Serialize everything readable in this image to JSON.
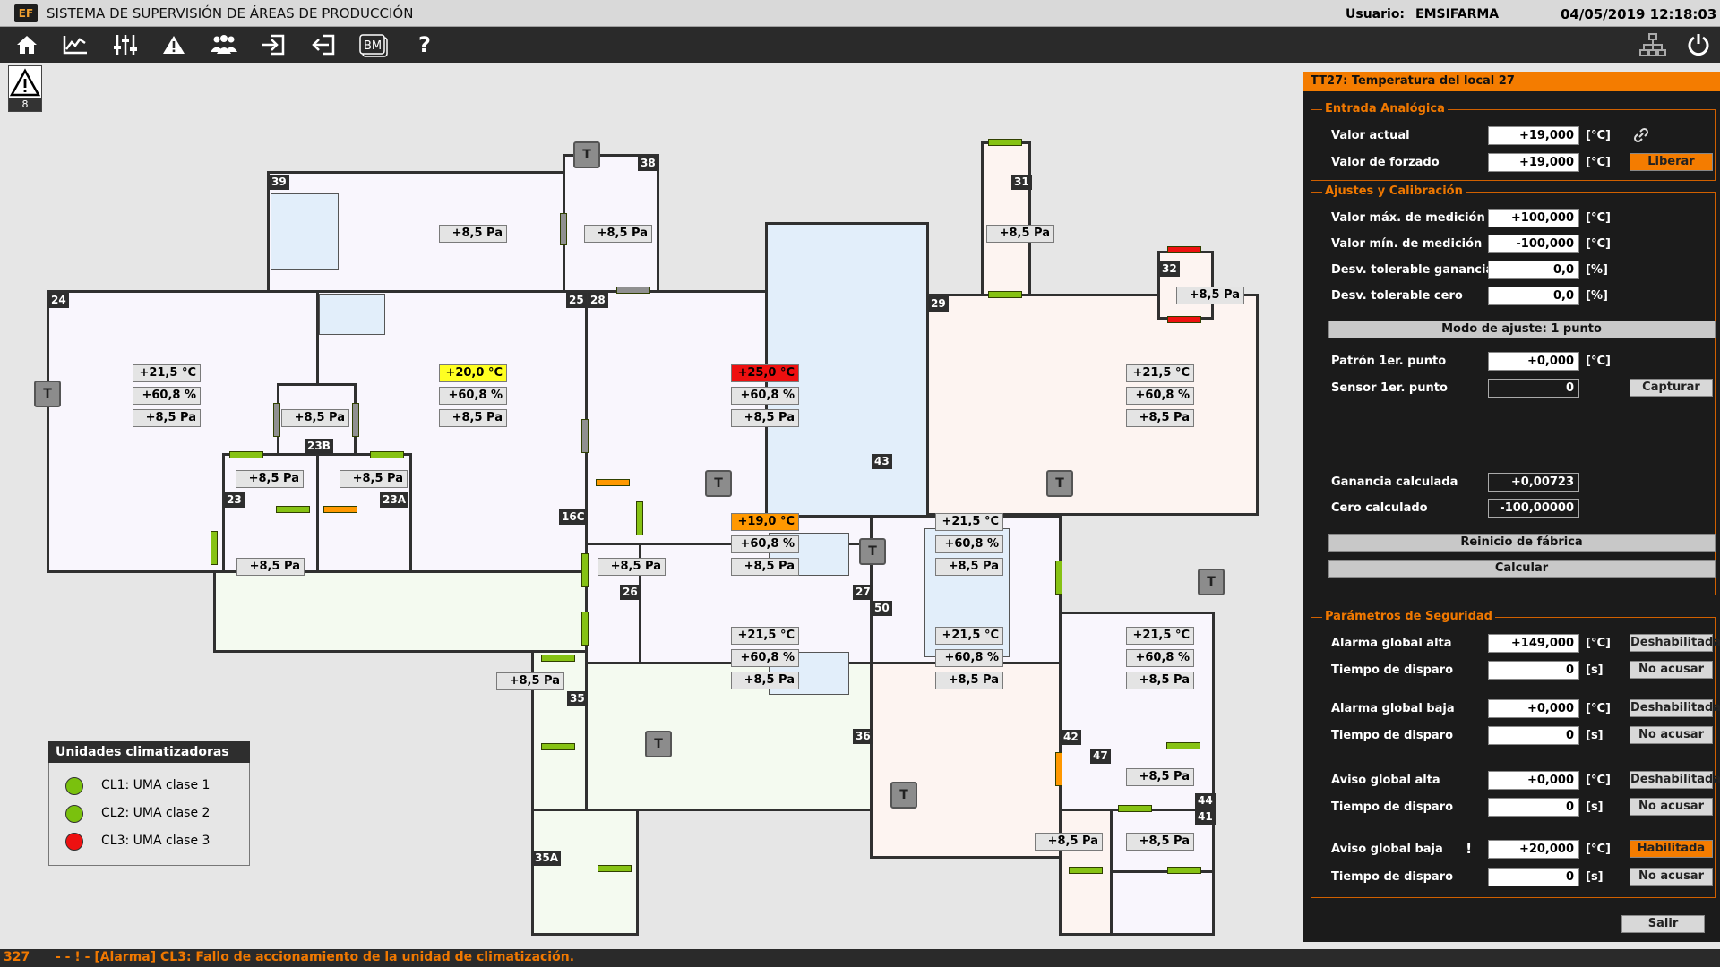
{
  "titlebar": {
    "logo": "EF",
    "title": "SISTEMA DE SUPERVISIÓN DE ÁREAS DE PRODUCCIÓN",
    "user_label": "Usuario:",
    "user_name": "EMSIFARMA",
    "datetime": "04/05/2019 12:18:03"
  },
  "toolbar": {
    "buttons": [
      "home-icon",
      "trend-chart-icon",
      "sliders-icon",
      "warning-icon",
      "users-icon",
      "login-icon",
      "logout-icon",
      "bms-icon",
      "help-icon"
    ],
    "right_buttons": [
      "network-icon",
      "power-icon"
    ],
    "bm_label": "BM",
    "help_label": "?"
  },
  "alarm_indicator": {
    "count": "8"
  },
  "map": {
    "rooms": [
      "39",
      "38",
      "24",
      "25",
      "28",
      "29",
      "31",
      "32",
      "23B",
      "23",
      "23A",
      "16C",
      "26",
      "27",
      "43",
      "50",
      "35",
      "36",
      "42",
      "47",
      "44",
      "41",
      "35A"
    ],
    "t_label": "T",
    "readings": {
      "r39": "+8,5 Pa",
      "r38": "+8,5 Pa",
      "r31": "+8,5 Pa",
      "r32": "+8,5 Pa",
      "r24_t": "+21,5 °C",
      "r24_h": "+60,8 %",
      "r24_p": "+8,5 Pa",
      "r23b": "+8,5 Pa",
      "r25_t": "+20,0 °C",
      "r25_h": "+60,8 %",
      "r25_p": "+8,5 Pa",
      "r28_t": "+25,0 °C",
      "r28_h": "+60,8 %",
      "r28_p": "+8,5 Pa",
      "r29_t": "+21,5 °C",
      "r29_h": "+60,8 %",
      "r29_p": "+8,5 Pa",
      "r23": "+8,5 Pa",
      "r23a": "+8,5 Pa",
      "r16c": "+8,5 Pa",
      "r26": "+8,5 Pa",
      "r27_t": "+19,0 °C",
      "r27_h": "+60,8 %",
      "r27_p": "+8,5 Pa",
      "r43_t": "+21,5 °C",
      "r43_h": "+60,8 %",
      "r43_p": "+8,5 Pa",
      "r36_t": "+21,5 °C",
      "r36_h": "+60,8 %",
      "r36_p": "+8,5 Pa",
      "r50_t": "+21,5 °C",
      "r50_h": "+60,8 %",
      "r50_p": "+8,5 Pa",
      "r42_t": "+21,5 °C",
      "r42_h": "+60,8 %",
      "r42_p": "+8,5 Pa",
      "r35": "+8,5 Pa",
      "r47": "+8,5 Pa",
      "r44": "+8,5 Pa",
      "r41": "+8,5 Pa"
    }
  },
  "legend": {
    "title": "Unidades climatizadoras",
    "items": [
      {
        "label": "CL1: UMA clase 1",
        "color": "#7ac10e"
      },
      {
        "label": "CL2: UMA clase 2",
        "color": "#7ac10e"
      },
      {
        "label": "CL3: UMA clase 3",
        "color": "#ee1111"
      }
    ]
  },
  "colors": {
    "accent": "#f47c00",
    "door_ok": "#86c214",
    "door_warn": "#ff9800",
    "door_alarm": "#ee1111",
    "door_closed": "#909090"
  },
  "panel": {
    "title": "TT27: Temperatura del local 27",
    "analog": {
      "title": "Entrada Analógica",
      "actual_label": "Valor actual",
      "actual_value": "+19,000",
      "actual_unit": "[°C]",
      "forced_label": "Valor de forzado",
      "forced_value": "+19,000",
      "forced_unit": "[°C]",
      "release_button": "Liberar"
    },
    "calibration": {
      "title": "Ajustes y Calibración",
      "rows": [
        {
          "label": "Valor máx. de medición",
          "value": "+100,000",
          "unit": "[°C]"
        },
        {
          "label": "Valor mín. de medición",
          "value": "-100,000",
          "unit": "[°C]"
        },
        {
          "label": "Desv. tolerable ganancia",
          "value": "0,0",
          "unit": "[%]"
        },
        {
          "label": "Desv. tolerable cero",
          "value": "0,0",
          "unit": "[%]"
        }
      ],
      "mode": "Modo de ajuste: 1 punto",
      "pattern_label": "Patrón 1er. punto",
      "pattern_value": "+0,000",
      "pattern_unit": "[°C]",
      "sensor_label": "Sensor 1er. punto",
      "sensor_value": "0",
      "capture_button": "Capturar",
      "gain_label": "Ganancia calculada",
      "gain_value": "+0,00723",
      "zero_label": "Cero calculado",
      "zero_value": "-100,00000",
      "reset_button": "Reinicio de fábrica",
      "calc_button": "Calcular"
    },
    "safety": {
      "title": "Parámetros de Seguridad",
      "rows": [
        {
          "label": "Alarma global alta",
          "value": "+149,000",
          "unit": "[°C]",
          "button": "Deshabilitada"
        },
        {
          "label": "Tiempo de disparo",
          "value": "0",
          "unit": "[s]",
          "button": "No acusar"
        },
        {
          "label": "Alarma global baja",
          "value": "+0,000",
          "unit": "[°C]",
          "button": "Deshabilitada"
        },
        {
          "label": "Tiempo de disparo",
          "value": "0",
          "unit": "[s]",
          "button": "No acusar"
        },
        {
          "label": "Aviso global alta",
          "value": "+0,000",
          "unit": "[°C]",
          "button": "Deshabilitada"
        },
        {
          "label": "Tiempo de disparo",
          "value": "0",
          "unit": "[s]",
          "button": "No acusar"
        },
        {
          "label": "Aviso global baja",
          "value": "+20,000",
          "unit": "[°C]",
          "button": "Habilitada",
          "flag": "!"
        },
        {
          "label": "Tiempo de disparo",
          "value": "0",
          "unit": "[s]",
          "button": "No acusar"
        }
      ]
    },
    "exit_button": "Salir"
  },
  "status": {
    "count": "327",
    "message": "- - ! - [Alarma] CL3: Fallo de accionamiento de la unidad de climatización."
  }
}
